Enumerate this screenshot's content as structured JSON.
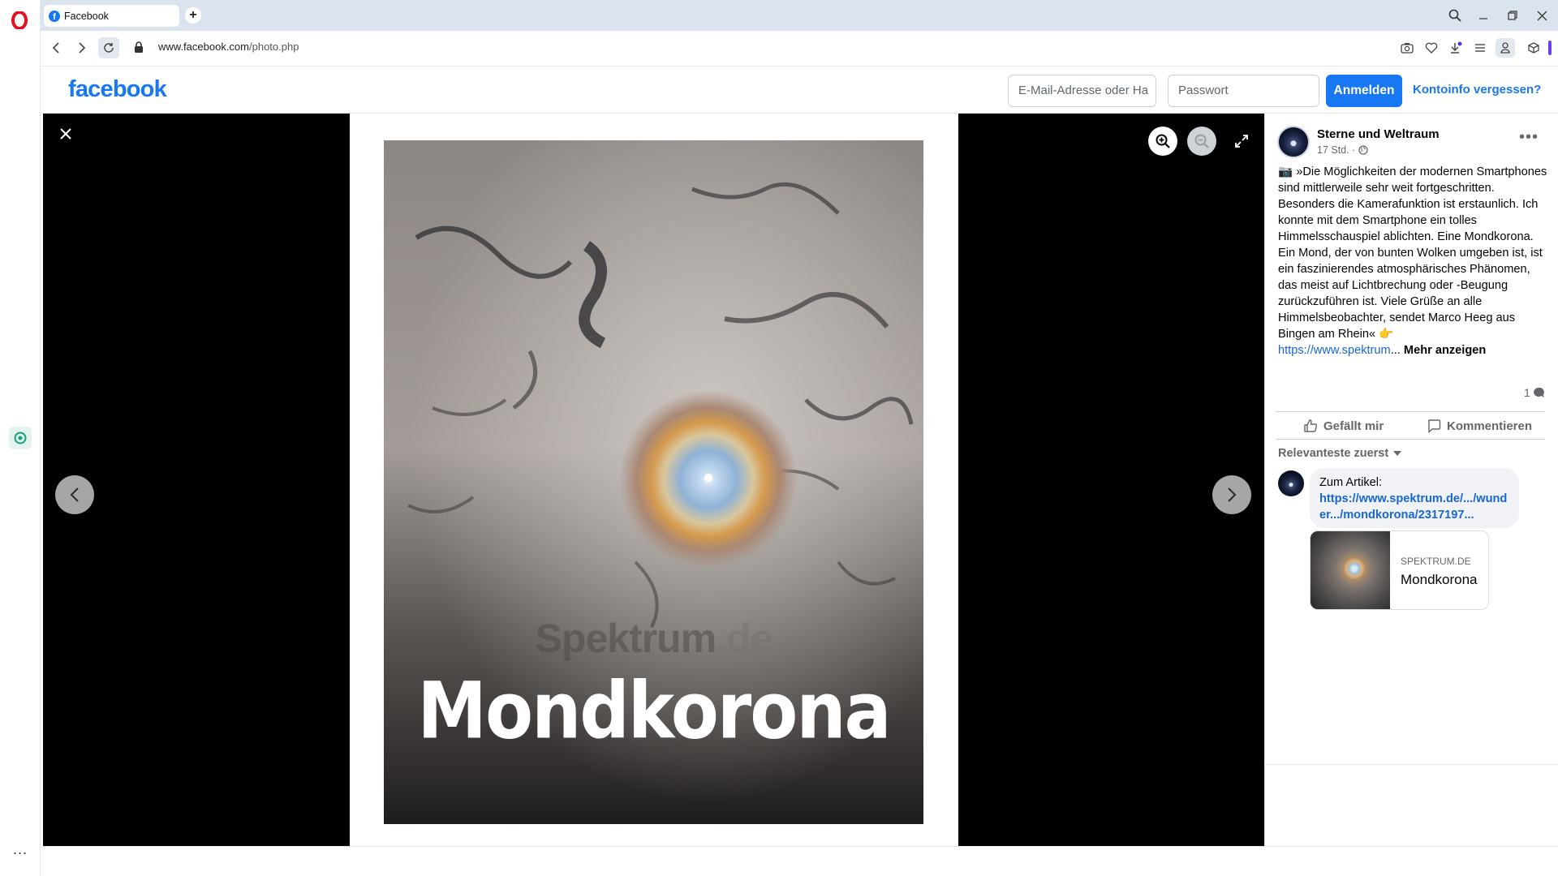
{
  "browser": {
    "tab_title": "Facebook",
    "new_tab_label": "+",
    "url_host": "www.facebook.com",
    "url_path": "/photo.php",
    "sidebar_more": "..."
  },
  "header": {
    "logo_text": "facebook",
    "email_placeholder": "E-Mail-Adresse oder Ha",
    "password_placeholder": "Passwort",
    "login_label": "Anmelden",
    "forgot_label": "Kontoinfo vergessen?"
  },
  "photo": {
    "watermark_brand": "Spektrum",
    "watermark_tld": ".de",
    "title": "Mondkorona"
  },
  "post": {
    "page_name": "Sterne und Weltraum",
    "time": "17 Std. ·",
    "text": "📷 »Die Möglichkeiten der modernen Smartphones sind mittlerweile sehr weit fortgeschritten. Besonders die Kamerafunktion ist erstaunlich. Ich konnte mit dem Smartphone ein tolles Himmelsschauspiel ablichten. Eine Mondkorona. Ein Mond, der von bunten Wolken umgeben ist, ist ein faszinierendes atmosphärisches Phänomen, das meist auf Lichtbrechung oder -Beugung zurückzuführen ist. Viele Grüße an alle Himmelsbeobachter, sendet Marco Heeg aus Bingen am Rhein« 👉",
    "link": "https://www.spektrum",
    "ellipsis": "...",
    "more_label": "Mehr anzeigen",
    "comment_count": "1",
    "like_label": "Gefällt mir",
    "comment_label": "Kommentieren",
    "sort_label": "Relevanteste zuerst"
  },
  "comment": {
    "text": "Zum Artikel:",
    "link": "https://www.spektrum.de/.../wunder.../mondkorona/2317197...",
    "card_domain": "SPEKTRUM.DE",
    "card_title": "Mondkorona"
  },
  "colors": {
    "brand": "#1877f2",
    "viewer_bg": "#000000",
    "link": "#1766d8"
  }
}
